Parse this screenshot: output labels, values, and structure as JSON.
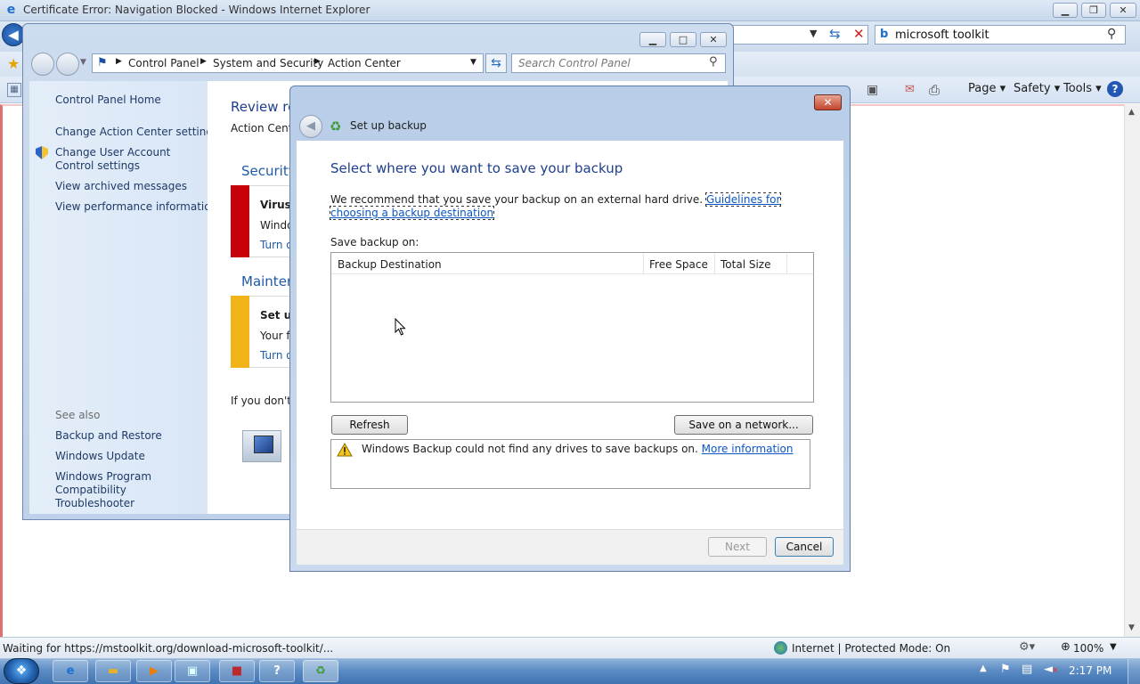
{
  "ie": {
    "window_title": "Certificate Error: Navigation Blocked - Windows Internet Explorer",
    "search_value": "microsoft toolkit",
    "menu": {
      "page": "Page",
      "safety": "Safety",
      "tools": "Tools"
    },
    "status_text": "Waiting for https://mstoolkit.org/download-microsoft-toolkit/...",
    "zone_text": "Internet | Protected Mode: On",
    "zoom": "100%"
  },
  "control_panel": {
    "breadcrumb": [
      "Control Panel",
      "System and Security",
      "Action Center"
    ],
    "search_placeholder": "Search Control Panel",
    "sidebar": {
      "home": "Control Panel Home",
      "links": [
        "Change Action Center settings",
        "Change User Account Control settings",
        "View archived messages",
        "View performance information"
      ],
      "see_also_label": "See also",
      "see_also": [
        "Backup and Restore",
        "Windows Update",
        "Windows Program Compatibility Troubleshooter"
      ]
    },
    "main": {
      "heading": "Review re",
      "subtitle": "Action Cente",
      "security_header": "Security",
      "virus_title": "Virus p",
      "virus_line": "Windo",
      "virus_link": "Turn o",
      "maintenance_header": "Mainter",
      "backup_title": "Set up",
      "backup_line": "Your f",
      "backup_link": "Turn o",
      "footer_text": "If you don't s"
    }
  },
  "dialog": {
    "title": "Set up backup",
    "heading": "Select where you want to save your backup",
    "recommend_text": "We recommend that you save your backup on an external hard drive.",
    "guidelines_link": "Guidelines for choosing a backup destination",
    "save_on_label": "Save backup on:",
    "columns": [
      "Backup Destination",
      "Free Space",
      "Total Size"
    ],
    "refresh_label": "Refresh",
    "network_label": "Save on a network...",
    "warning_text": "Windows Backup could not find any drives to save backups on.",
    "more_info_link": "More information",
    "next_label": "Next",
    "cancel_label": "Cancel"
  },
  "taskbar": {
    "clock": "2:17 PM"
  },
  "colors": {
    "security_bar": "#c8000a",
    "maintenance_bar": "#f0b418",
    "heading_blue": "#1e3f8c",
    "link_blue": "#0b56c4"
  }
}
